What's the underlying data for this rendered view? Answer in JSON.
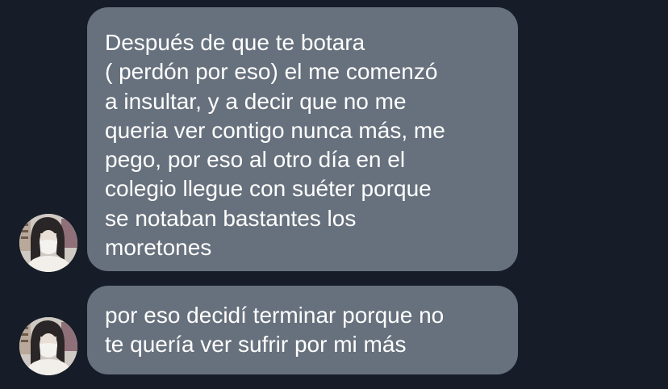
{
  "messages": [
    {
      "lines": [
        "Después de que te botara",
        "( perdón por eso) el me comenzó",
        "a insultar, y a decir que no me",
        "queria ver contigo nunca más, me",
        "pego, por eso al otro día en el",
        "colegio llegue con suéter porque",
        "se notaban bastantes los",
        "moretones"
      ]
    },
    {
      "lines": [
        "por eso decidí terminar porque no",
        "te quería ver sufrir por mi más"
      ]
    }
  ],
  "colors": {
    "background": "#161d28",
    "bubble": "#67717d",
    "text": "#ffffff"
  }
}
